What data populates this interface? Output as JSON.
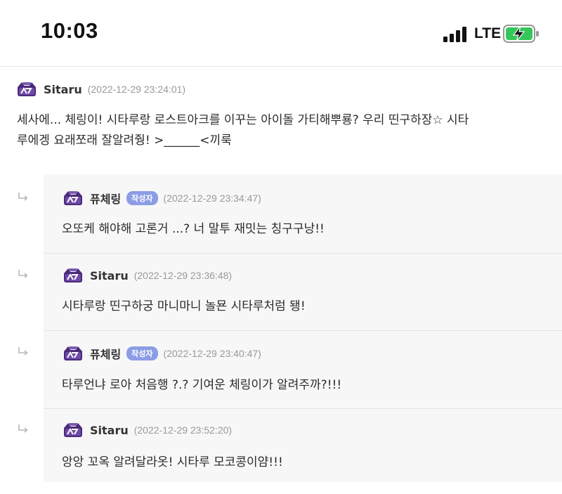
{
  "status_bar": {
    "time": "10:03",
    "network": "LTE"
  },
  "comments": {
    "main": {
      "author": "Sitaru",
      "date": "(2022-12-29 23:24:01)",
      "text_line1": "세사에... 체링이! 시타루랑 로스트아크를 이꾸는 아이돌 가티해뿌룡? 우리 띤구하장☆ 시타",
      "text_line2": "루에겡 요래쪼래 잘알려줭! >______<끼룩"
    },
    "replies": [
      {
        "author": "퓨체링",
        "badge": "작성자",
        "date": "(2022-12-29 23:34:47)",
        "text": "오또케 해야해 고론거 ...? 너 말투 재밋는 칭구구낭!!"
      },
      {
        "author": "Sitaru",
        "date": "(2022-12-29 23:36:48)",
        "text": "시타루랑 띤구하궁 마니마니 놀묜 시타루처럼 됑!"
      },
      {
        "author": "퓨체링",
        "badge": "작성자",
        "date": "(2022-12-29 23:40:47)",
        "text": "타루언냐 로아 처음행 ?.? 기여운 체링이가 알려주까?!!!"
      },
      {
        "author": "Sitaru",
        "date": "(2022-12-29 23:52:20)",
        "text": "앙앙 꼬옥 알려달라옷! 시타루 모코콩이얌!!!"
      }
    ]
  },
  "icons": {
    "signal": "cellular-signal-icon",
    "battery": "battery-charging-icon",
    "level": "member-level-icon",
    "reply": "reply-arrow-icon"
  },
  "colors": {
    "badge": "#8c9de6",
    "level_icon": "#4b2a7b",
    "battery_charge": "#34c759",
    "reply_bg": "#f7f7f7"
  }
}
